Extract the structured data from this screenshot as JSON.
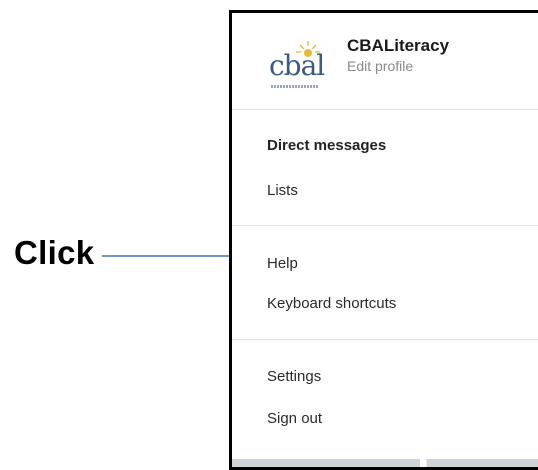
{
  "annotation": {
    "label": "Click"
  },
  "profile": {
    "logo_text": "cbal",
    "name": "CBALiteracy",
    "subtitle": "Edit profile"
  },
  "menu": {
    "items": [
      {
        "label": "Direct messages"
      },
      {
        "label": "Lists"
      },
      {
        "label": "Help"
      },
      {
        "label": "Keyboard shortcuts"
      },
      {
        "label": "Settings"
      },
      {
        "label": "Sign out"
      }
    ]
  },
  "colors": {
    "annotation_arrow": "#4a6fa5",
    "menu_border": "#000000",
    "divider": "#e1e3e6",
    "logo": "#3b5a8a",
    "logo_sun": "#e6b93a"
  }
}
